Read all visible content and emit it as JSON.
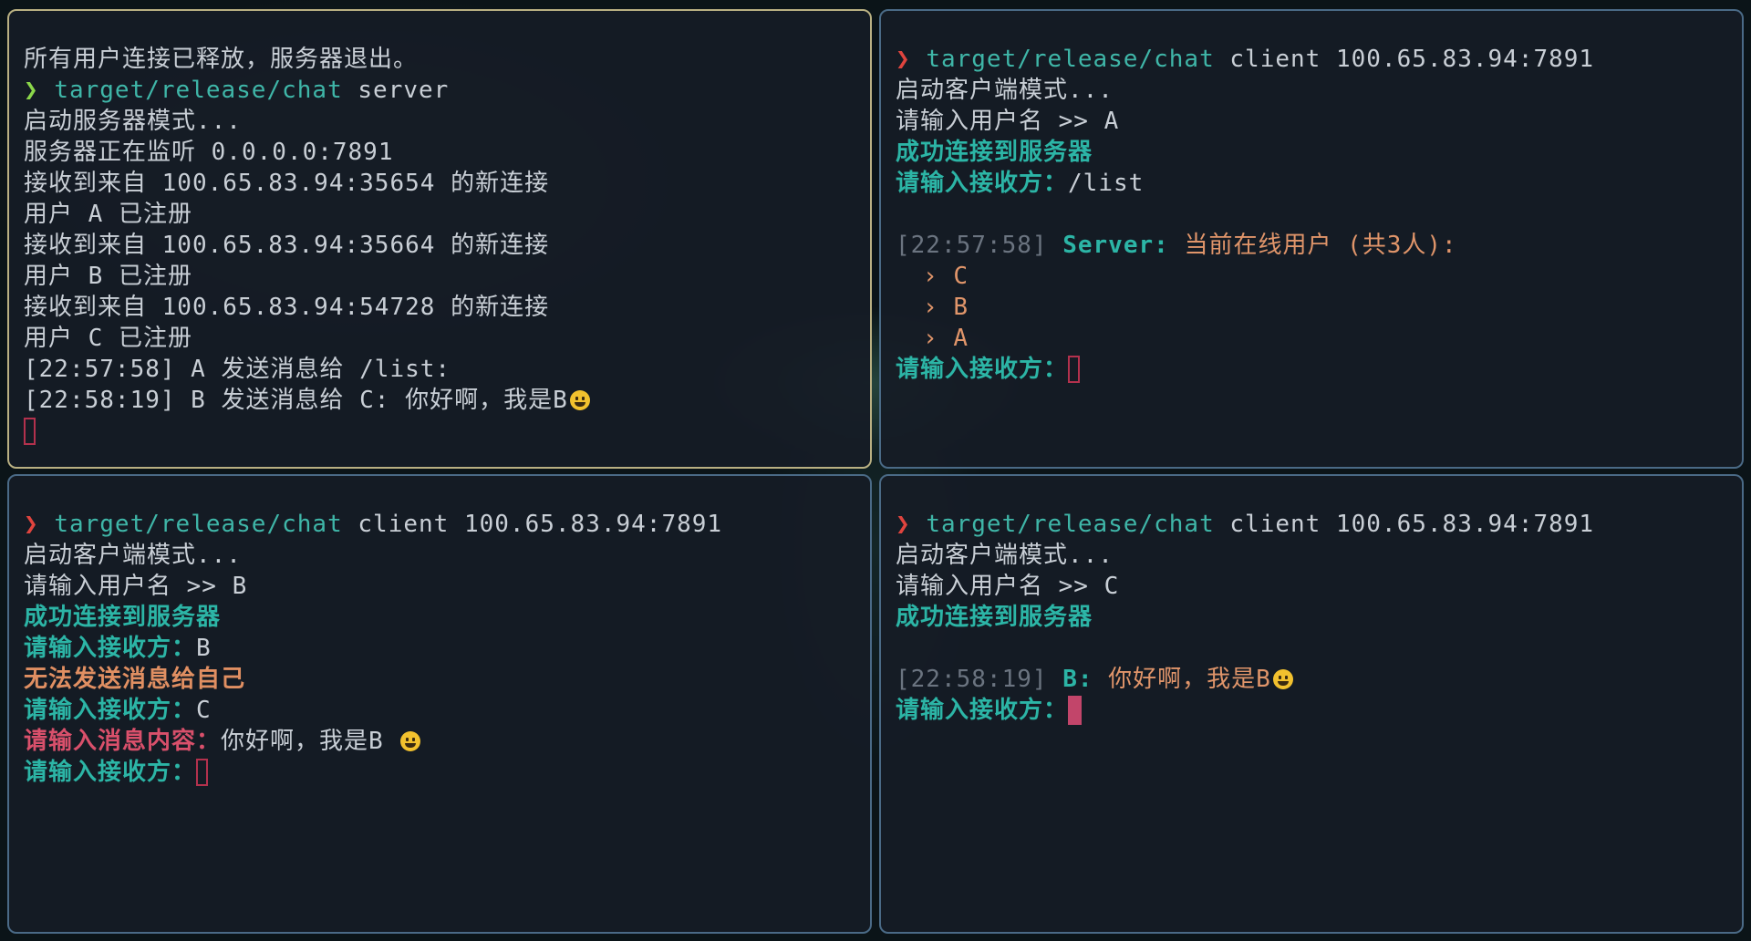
{
  "panes": {
    "server": {
      "lines": [
        "所有用户连接已释放，服务器退出。",
        "target/release/chat",
        "server",
        "启动服务器模式...",
        "服务器正在监听 0.0.0.0:7891",
        "接收到来自 100.65.83.94:35654 的新连接",
        "用户 A 已注册",
        "接收到来自 100.65.83.94:35664 的新连接",
        "用户 B 已注册",
        "接收到来自 100.65.83.94:54728 的新连接",
        "用户 C 已注册",
        "[22:57:58] A 发送消息给 /list:",
        "[22:58:19] B 发送消息给 C: 你好啊，我是B"
      ],
      "prompt_symbol": "❯"
    },
    "client_a": {
      "prompt_symbol": "❯",
      "cmd_path": "target/release/chat",
      "cmd_args": "client 100.65.83.94:7891",
      "start": "启动客户端模式...",
      "username_prompt": "请输入用户名 >> ",
      "username": "A",
      "connected": "成功连接到服务器",
      "recipient_prompt": "请输入接收方：",
      "recipient_value": "/list",
      "ts_open": "[",
      "timestamp": "22:57:58",
      "ts_close": "]",
      "sender": "Server:",
      "online_msg": "当前在线用户 (共3人):",
      "bullet": "›",
      "users": [
        "C",
        "B",
        "A"
      ],
      "recipient_prompt_2": "请输入接收方："
    },
    "client_b": {
      "prompt_symbol": "❯",
      "cmd_path": "target/release/chat",
      "cmd_args": "client 100.65.83.94:7891",
      "start": "启动客户端模式...",
      "username_prompt": "请输入用户名 >> ",
      "username": "B",
      "connected": "成功连接到服务器",
      "recipient_prompt": "请输入接收方：",
      "recipient_value_1": "B",
      "error_self": "无法发送消息给自己",
      "recipient_value_2": "C",
      "message_prompt": "请输入消息内容：",
      "message_value": "你好啊，我是B ",
      "recipient_prompt_3": "请输入接收方："
    },
    "client_c": {
      "prompt_symbol": "❯",
      "cmd_path": "target/release/chat",
      "cmd_args": "client 100.65.83.94:7891",
      "start": "启动客户端模式...",
      "username_prompt": "请输入用户名 >> ",
      "username": "C",
      "connected": "成功连接到服务器",
      "ts_open": "[",
      "timestamp": "22:58:19",
      "ts_close": "]",
      "sender": "B:",
      "message": "你好啊，我是B",
      "recipient_prompt": "请输入接收方："
    }
  },
  "colors": {
    "accent_teal": "#2cb5a6",
    "error_orange": "#e08f62",
    "prompt_pink": "#d9506b",
    "prompt_red": "#e0443e",
    "prompt_green": "#8bd74a",
    "active_border": "#b9b082",
    "inactive_border": "#4a6a86"
  },
  "icons": [
    "smiley-emoji-icon",
    "cursor-icon"
  ]
}
